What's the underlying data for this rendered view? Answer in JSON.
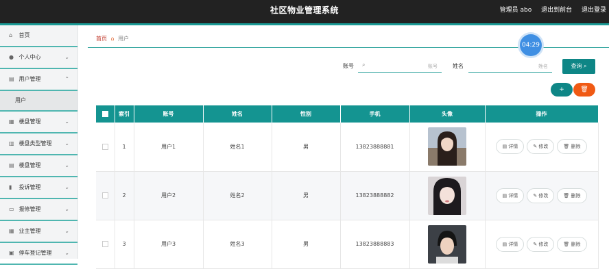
{
  "header": {
    "title": "社区物业管理系统",
    "admin_label": "管理员 abo",
    "exit_front": "退出到前台",
    "logout": "退出登录"
  },
  "sidebar": {
    "items": [
      {
        "label": "首页",
        "icon": "home-icon"
      },
      {
        "label": "个人中心",
        "icon": "user-icon"
      },
      {
        "label": "用户管理",
        "icon": "clipboard-icon",
        "expanded": true
      },
      {
        "label": "楼盘管理",
        "icon": "building-icon"
      },
      {
        "label": "楼盘类型管理",
        "icon": "chart-icon"
      },
      {
        "label": "楼盘管理",
        "icon": "clipboard-icon"
      },
      {
        "label": "投诉管理",
        "icon": "bar-chart-icon"
      },
      {
        "label": "报修管理",
        "icon": "message-icon"
      },
      {
        "label": "业主管理",
        "icon": "grid-icon"
      },
      {
        "label": "停车登记管理",
        "icon": "car-icon"
      }
    ],
    "sub_item": "用户"
  },
  "breadcrumb": {
    "home": "首页",
    "current": "用户"
  },
  "timer": "04:29",
  "search": {
    "account_label": "账号",
    "account_placeholder": "账号",
    "name_label": "姓名",
    "name_placeholder": "姓名",
    "query_button": "查询 ⌕"
  },
  "actions": {
    "add": "+",
    "delete": "🗑"
  },
  "table": {
    "headers": [
      "",
      "索引",
      "账号",
      "姓名",
      "性别",
      "手机",
      "头像",
      "操作"
    ],
    "rows": [
      {
        "index": "1",
        "account": "用户1",
        "name": "姓名1",
        "gender": "男",
        "phone": "13823888881"
      },
      {
        "index": "2",
        "account": "用户2",
        "name": "姓名2",
        "gender": "男",
        "phone": "13823888882"
      },
      {
        "index": "3",
        "account": "用户3",
        "name": "姓名3",
        "gender": "男",
        "phone": "13823888883"
      }
    ],
    "op_detail": "详情",
    "op_edit": "修改",
    "op_delete": "删除"
  },
  "colors": {
    "accent": "#149491",
    "danger": "#f05a14",
    "topbar": "#222222"
  }
}
